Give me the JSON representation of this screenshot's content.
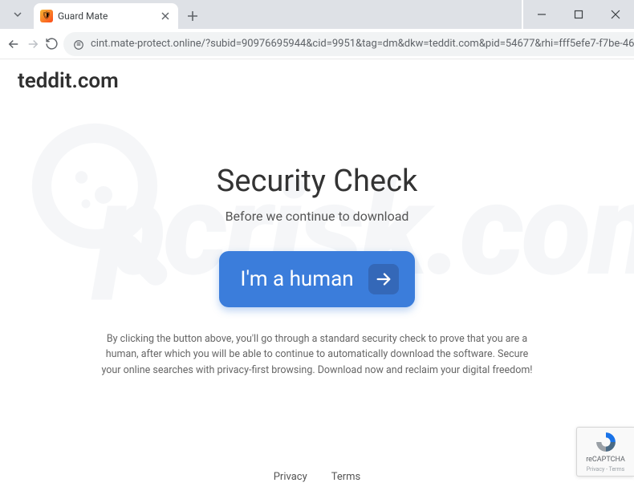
{
  "window": {
    "tab_title": "Guard Mate",
    "url": "cint.mate-protect.online/?subid=90976695944&cid=9951&tag=dm&dkw=teddit.com&pid=54677&rhi=fff5efe7-f7be-46..."
  },
  "page": {
    "domain": "teddit.com",
    "heading": "Security Check",
    "subheading": "Before we continue to download",
    "cta_label": "I'm a human",
    "disclaimer": "By clicking the button above, you'll go through a standard security check to prove that you are a human, after which you will be able to continue to automatically download the software. Secure your online searches with privacy-first browsing. Download now and reclaim your digital freedom!",
    "footer": {
      "privacy": "Privacy",
      "terms": "Terms"
    }
  },
  "recaptcha": {
    "line1": "reCAPTCHA",
    "line2": "Privacy - Terms"
  },
  "watermark": {
    "text": "pcrisk.com"
  }
}
